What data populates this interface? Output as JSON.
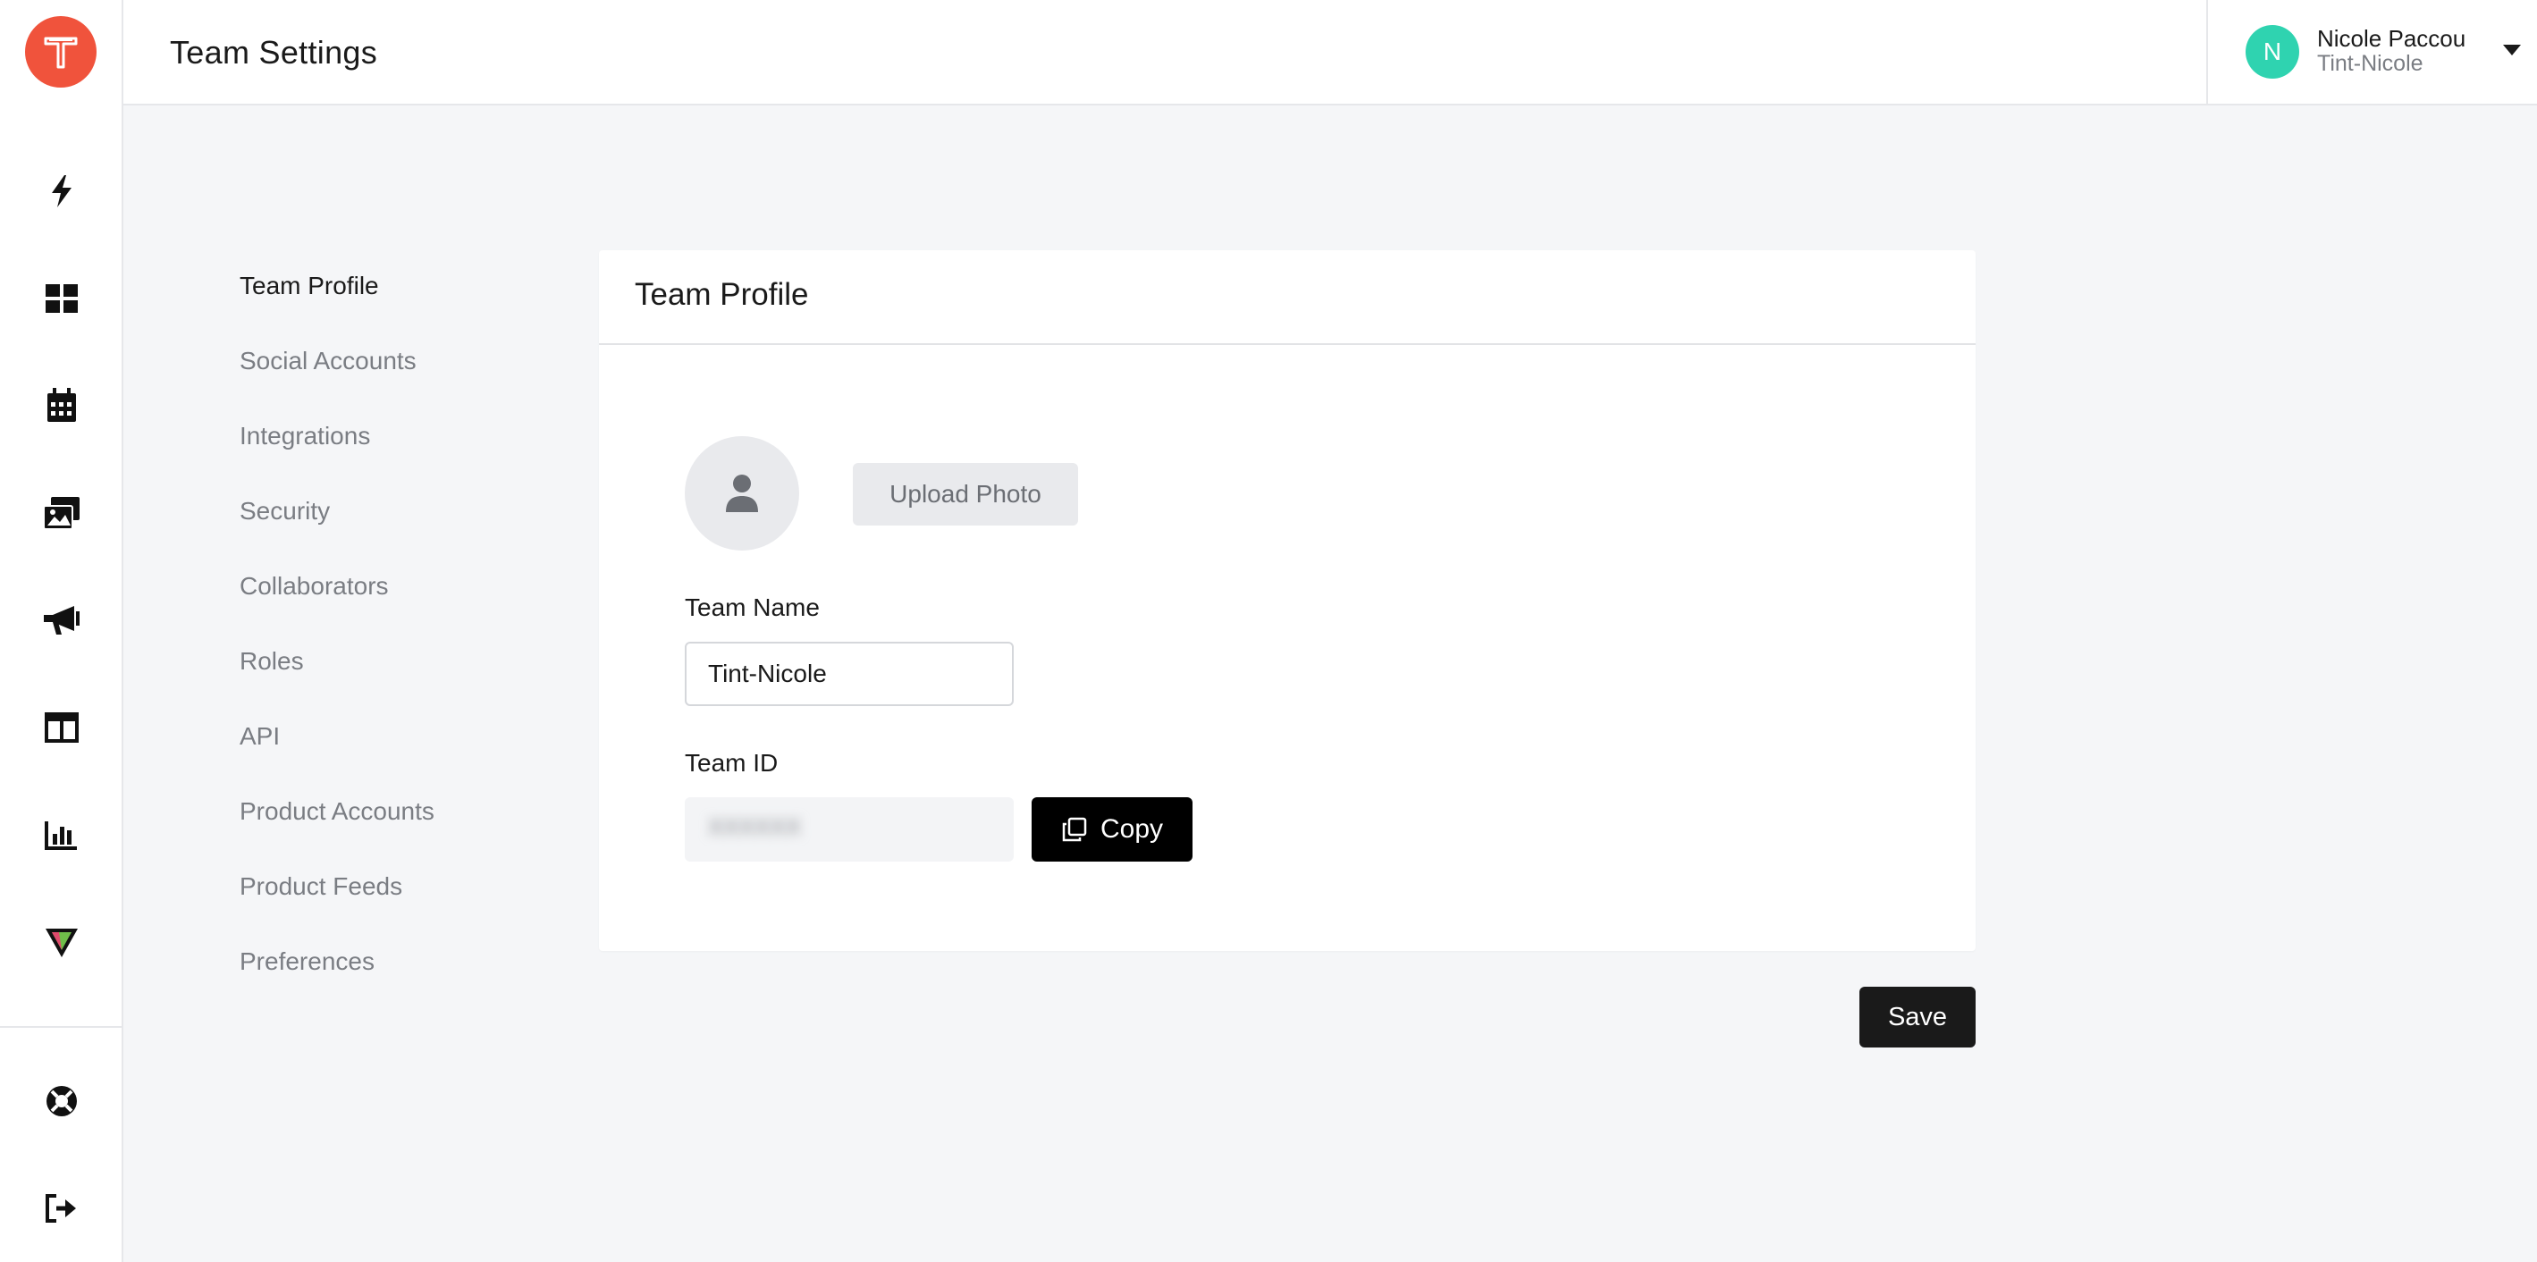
{
  "app": {
    "logo_letter": "T",
    "brand_color": "#f0533c"
  },
  "rail": {
    "icons": [
      "bolt-icon",
      "dashboard-grid-icon",
      "calendar-icon",
      "media-gallery-icon",
      "megaphone-icon",
      "layout-columns-icon",
      "analytics-bar-chart-icon",
      "vibe-logo-icon"
    ],
    "bottom_icons": [
      "support-lifebuoy-icon",
      "logout-icon"
    ]
  },
  "header": {
    "title": "Team Settings",
    "user": {
      "initial": "N",
      "name": "Nicole Paccou",
      "team": "Tint-Nicole",
      "avatar_color": "#2fd3b0"
    }
  },
  "settings_nav": {
    "items": [
      {
        "label": "Team Profile",
        "active": true
      },
      {
        "label": "Social Accounts",
        "active": false
      },
      {
        "label": "Integrations",
        "active": false
      },
      {
        "label": "Security",
        "active": false
      },
      {
        "label": "Collaborators",
        "active": false
      },
      {
        "label": "Roles",
        "active": false
      },
      {
        "label": "API",
        "active": false
      },
      {
        "label": "Product Accounts",
        "active": false
      },
      {
        "label": "Product Feeds",
        "active": false
      },
      {
        "label": "Preferences",
        "active": false
      }
    ]
  },
  "profile_card": {
    "title": "Team Profile",
    "upload_label": "Upload Photo",
    "team_name_label": "Team Name",
    "team_name_value": "Tint-Nicole",
    "team_id_label": "Team ID",
    "team_id_value": "XXXXXX",
    "copy_label": "Copy"
  },
  "actions": {
    "save_label": "Save"
  }
}
